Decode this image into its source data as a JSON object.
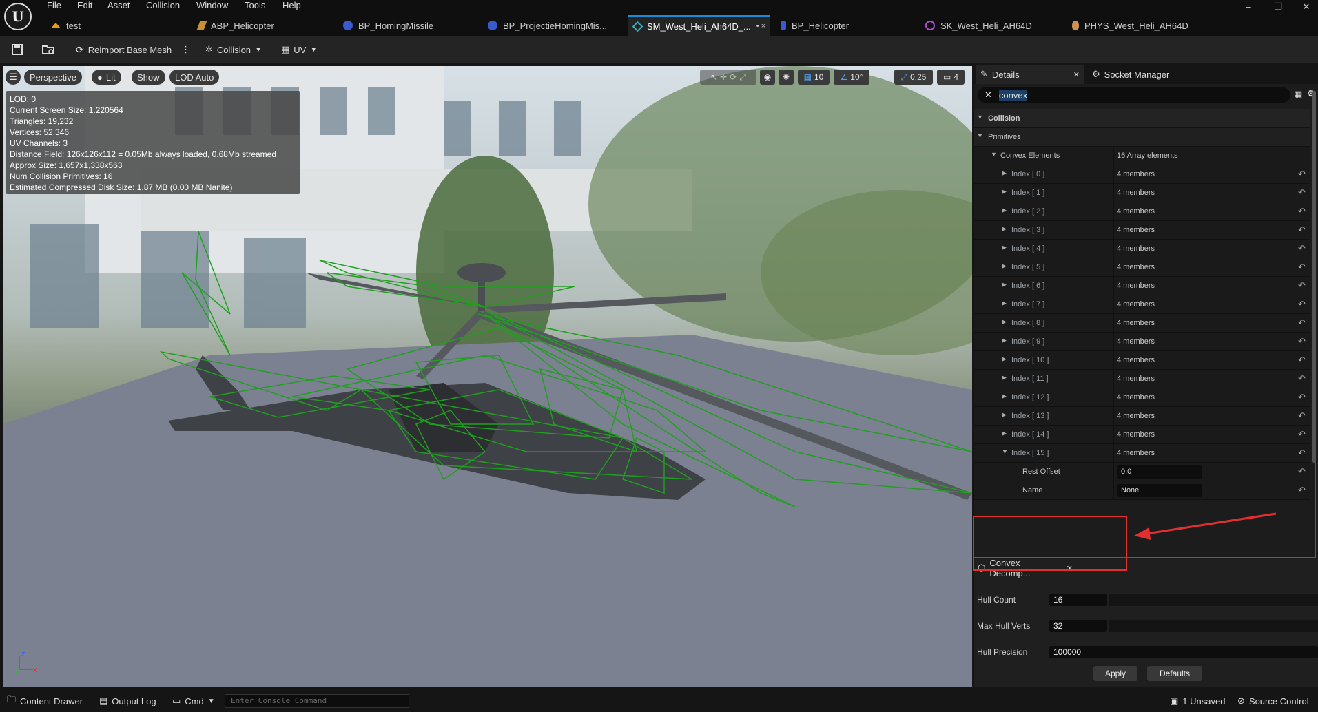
{
  "menu": [
    "File",
    "Edit",
    "Asset",
    "Collision",
    "Window",
    "Tools",
    "Help"
  ],
  "tabs": [
    {
      "label": "test",
      "color": "#e0a020"
    },
    {
      "label": "ABP_Helicopter",
      "color": "#c89030"
    },
    {
      "label": "BP_HomingMissile",
      "color": "#3a5ad0"
    },
    {
      "label": "BP_ProjectieHomingMis...",
      "color": "#3a5ad0"
    },
    {
      "label": "SM_West_Heli_Ah64D_...",
      "color": "#38b0c0"
    },
    {
      "label": "BP_Helicopter",
      "color": "#3a5ad0"
    },
    {
      "label": "SK_West_Heli_AH64D",
      "color": "#b050d0"
    },
    {
      "label": "PHYS_West_Heli_AH64D",
      "color": "#d09050"
    }
  ],
  "toolbar": {
    "reimport": "Reimport Base Mesh",
    "collision": "Collision",
    "uv": "UV"
  },
  "viewport": {
    "perspective": "Perspective",
    "lit": "Lit",
    "show": "Show",
    "lod": "LOD Auto",
    "grid_snap": "10",
    "rot_snap": "10°",
    "scale_snap": "0.25",
    "camera_speed": "4",
    "stats": [
      "LOD:  0",
      "Current Screen Size:  1.220564",
      "Triangles:  19,232",
      "Vertices:  52,346",
      "UV Channels:  3",
      "Distance Field:  126x126x112 = 0.05Mb always loaded, 0.68Mb streamed",
      "Approx Size:  1,657x1,338x563",
      "Num Collision Primitives:  16",
      "Estimated Compressed Disk Size:  1.87 MB (0.00 MB Nanite)"
    ]
  },
  "details": {
    "tab_label": "Details",
    "socket_tab": "Socket Manager",
    "search_value": "convex",
    "collision": "Collision",
    "primitives": "Primitives",
    "convex_elements": "Convex Elements",
    "convex_value": "16 Array elements",
    "indices": [
      {
        "label": "Index [ 0 ]",
        "value": "4 members"
      },
      {
        "label": "Index [ 1 ]",
        "value": "4 members"
      },
      {
        "label": "Index [ 2 ]",
        "value": "4 members"
      },
      {
        "label": "Index [ 3 ]",
        "value": "4 members"
      },
      {
        "label": "Index [ 4 ]",
        "value": "4 members"
      },
      {
        "label": "Index [ 5 ]",
        "value": "4 members"
      },
      {
        "label": "Index [ 6 ]",
        "value": "4 members"
      },
      {
        "label": "Index [ 7 ]",
        "value": "4 members"
      },
      {
        "label": "Index [ 8 ]",
        "value": "4 members"
      },
      {
        "label": "Index [ 9 ]",
        "value": "4 members"
      },
      {
        "label": "Index [ 10 ]",
        "value": "4 members"
      },
      {
        "label": "Index [ 11 ]",
        "value": "4 members"
      },
      {
        "label": "Index [ 12 ]",
        "value": "4 members"
      },
      {
        "label": "Index [ 13 ]",
        "value": "4 members"
      },
      {
        "label": "Index [ 14 ]",
        "value": "4 members"
      },
      {
        "label": "Index [ 15 ]",
        "value": "4 members"
      }
    ],
    "rest_offset_label": "Rest Offset",
    "rest_offset_value": "0.0",
    "name_label": "Name",
    "name_value": "None"
  },
  "convex_decomp": {
    "tab_label": "Convex Decomp...",
    "hull_count_label": "Hull Count",
    "hull_count_value": "16",
    "max_hull_verts_label": "Max Hull Verts",
    "max_hull_verts_value": "32",
    "hull_precision_label": "Hull Precision",
    "hull_precision_value": "100000",
    "apply": "Apply",
    "defaults": "Defaults"
  },
  "bottom": {
    "content_drawer": "Content Drawer",
    "output_log": "Output Log",
    "cmd": "Cmd",
    "console_placeholder": "Enter Console Command",
    "unsaved": "1 Unsaved",
    "source_control": "Source Control"
  },
  "colors": {
    "accent": "#1a8bd6",
    "highlight": "#e23030",
    "collision_wire": "#1fa01f"
  }
}
